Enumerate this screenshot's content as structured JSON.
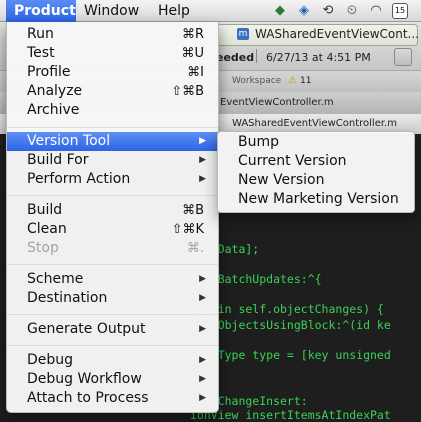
{
  "menubar": {
    "items": [
      {
        "label": "Product",
        "active": true
      },
      {
        "label": "Window"
      },
      {
        "label": "Help"
      }
    ],
    "clock_badge": "15"
  },
  "background": {
    "tab_title": "WASharedEventViewCont...",
    "status_fragment": "eeded",
    "status_time": "6/27/13 at 4:51 PM",
    "workspace_label": "Workspace",
    "warning_count": "11",
    "editor_tab": "EventViewController.m",
    "jump_path": "WASharedEventViewController.m",
    "code_lines": [
      "loadData];",
      "formBatchUpdates:^{",
      "nge in self.objectChanges) {",
      "sAndObjectsUsingBlock:^(id ke",
      "angeType type = [key unsigned",
      "ultsChangeInsert:",
      "ionView insertItemsAtIndexPat"
    ]
  },
  "product_menu": {
    "groups": [
      [
        {
          "label": "Run",
          "shortcut": "⌘R"
        },
        {
          "label": "Test",
          "shortcut": "⌘U"
        },
        {
          "label": "Profile",
          "shortcut": "⌘I"
        },
        {
          "label": "Analyze",
          "shortcut": "⇧⌘B"
        },
        {
          "label": "Archive",
          "shortcut": ""
        }
      ],
      [
        {
          "label": "Version Tool",
          "submenu": true,
          "highlighted": true
        },
        {
          "label": "Build For",
          "submenu": true
        },
        {
          "label": "Perform Action",
          "submenu": true
        }
      ],
      [
        {
          "label": "Build",
          "shortcut": "⌘B"
        },
        {
          "label": "Clean",
          "shortcut": "⇧⌘K"
        },
        {
          "label": "Stop",
          "shortcut": "⌘.",
          "disabled": true
        }
      ],
      [
        {
          "label": "Scheme",
          "submenu": true
        },
        {
          "label": "Destination",
          "submenu": true
        }
      ],
      [
        {
          "label": "Generate Output",
          "submenu": true
        }
      ],
      [
        {
          "label": "Debug",
          "submenu": true
        },
        {
          "label": "Debug Workflow",
          "submenu": true
        },
        {
          "label": "Attach to Process",
          "submenu": true
        }
      ]
    ]
  },
  "version_submenu": {
    "items": [
      "Bump",
      "Current Version",
      "New Version",
      "New Marketing Version"
    ]
  },
  "colors": {
    "highlight": "#2d64e5",
    "code": "#39d353",
    "editor_bg": "#1e1e1e"
  }
}
